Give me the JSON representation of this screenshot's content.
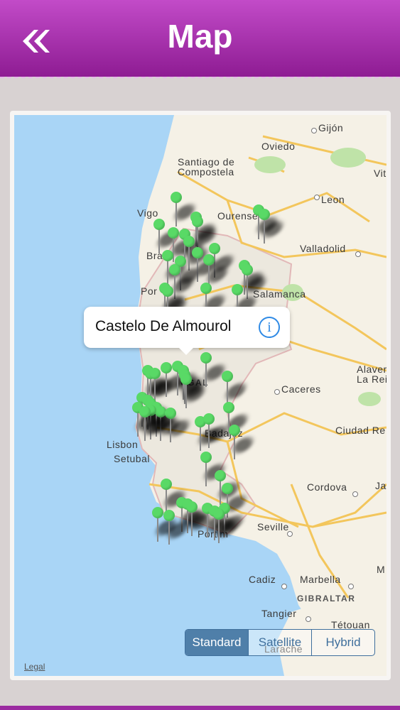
{
  "header": {
    "title": "Map",
    "back_icon": "double-chevron-left-icon"
  },
  "callout": {
    "title": "Castelo De Almourol",
    "info_icon": "info-icon",
    "info_glyph": "i"
  },
  "map_type": {
    "options": [
      "Standard",
      "Satellite",
      "Hybrid"
    ],
    "selected": "Standard"
  },
  "legal": "Legal",
  "cities": [
    {
      "name": "Gijón"
    },
    {
      "name": "Oviedo"
    },
    {
      "name": "Santiago de"
    },
    {
      "name": "Compostela"
    },
    {
      "name": "Vigo"
    },
    {
      "name": "Ourense"
    },
    {
      "name": "Leon"
    },
    {
      "name": "Valladolid"
    },
    {
      "name": "Bra"
    },
    {
      "name": "Por"
    },
    {
      "name": "Salamanca"
    },
    {
      "name": "Alaver"
    },
    {
      "name": "La Rei"
    },
    {
      "name": "Caceres"
    },
    {
      "name": "UGAL"
    },
    {
      "name": "Lisbon"
    },
    {
      "name": "Setubal"
    },
    {
      "name": "Badajoz"
    },
    {
      "name": "Ciudad Re"
    },
    {
      "name": "Cordova"
    },
    {
      "name": "Seville"
    },
    {
      "name": "Portim"
    },
    {
      "name": "Cadiz"
    },
    {
      "name": "Marbella"
    },
    {
      "name": "GIBRALTAR"
    },
    {
      "name": "Tangier"
    },
    {
      "name": "Tétouan"
    },
    {
      "name": "Larache"
    },
    {
      "name": "Vit"
    },
    {
      "name": "J"
    },
    {
      "name": "Ja"
    },
    {
      "name": "M"
    }
  ]
}
